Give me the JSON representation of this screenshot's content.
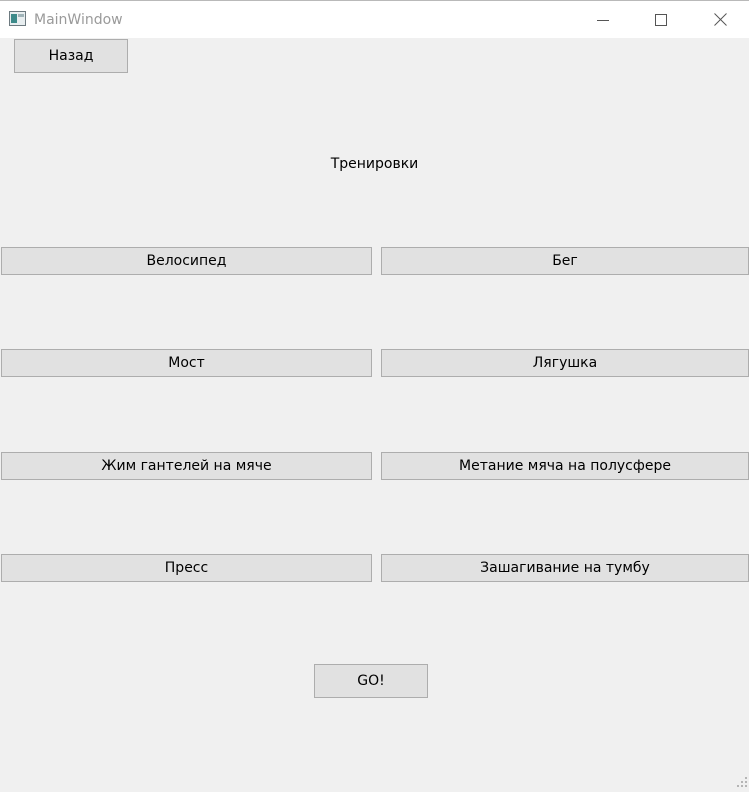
{
  "window": {
    "title": "MainWindow",
    "icon": "app-window-icon",
    "controls": [
      "minimize-icon",
      "maximize-icon",
      "close-icon"
    ]
  },
  "back_button": {
    "label": "Назад"
  },
  "heading": "Тренировки",
  "exercises": {
    "left": [
      "Велосипед",
      "Мост",
      "Жим гантелей на мяче",
      "Пресс"
    ],
    "right": [
      "Бег",
      "Лягушка",
      "Метание мяча на полусфере",
      "Зашагивание на тумбу"
    ]
  },
  "go_button": {
    "label": "GO!"
  },
  "colors": {
    "background": "#f0f0f0",
    "button_face": "#e1e1e1",
    "button_border": "#adadad",
    "title_text": "#9a9a9a"
  }
}
